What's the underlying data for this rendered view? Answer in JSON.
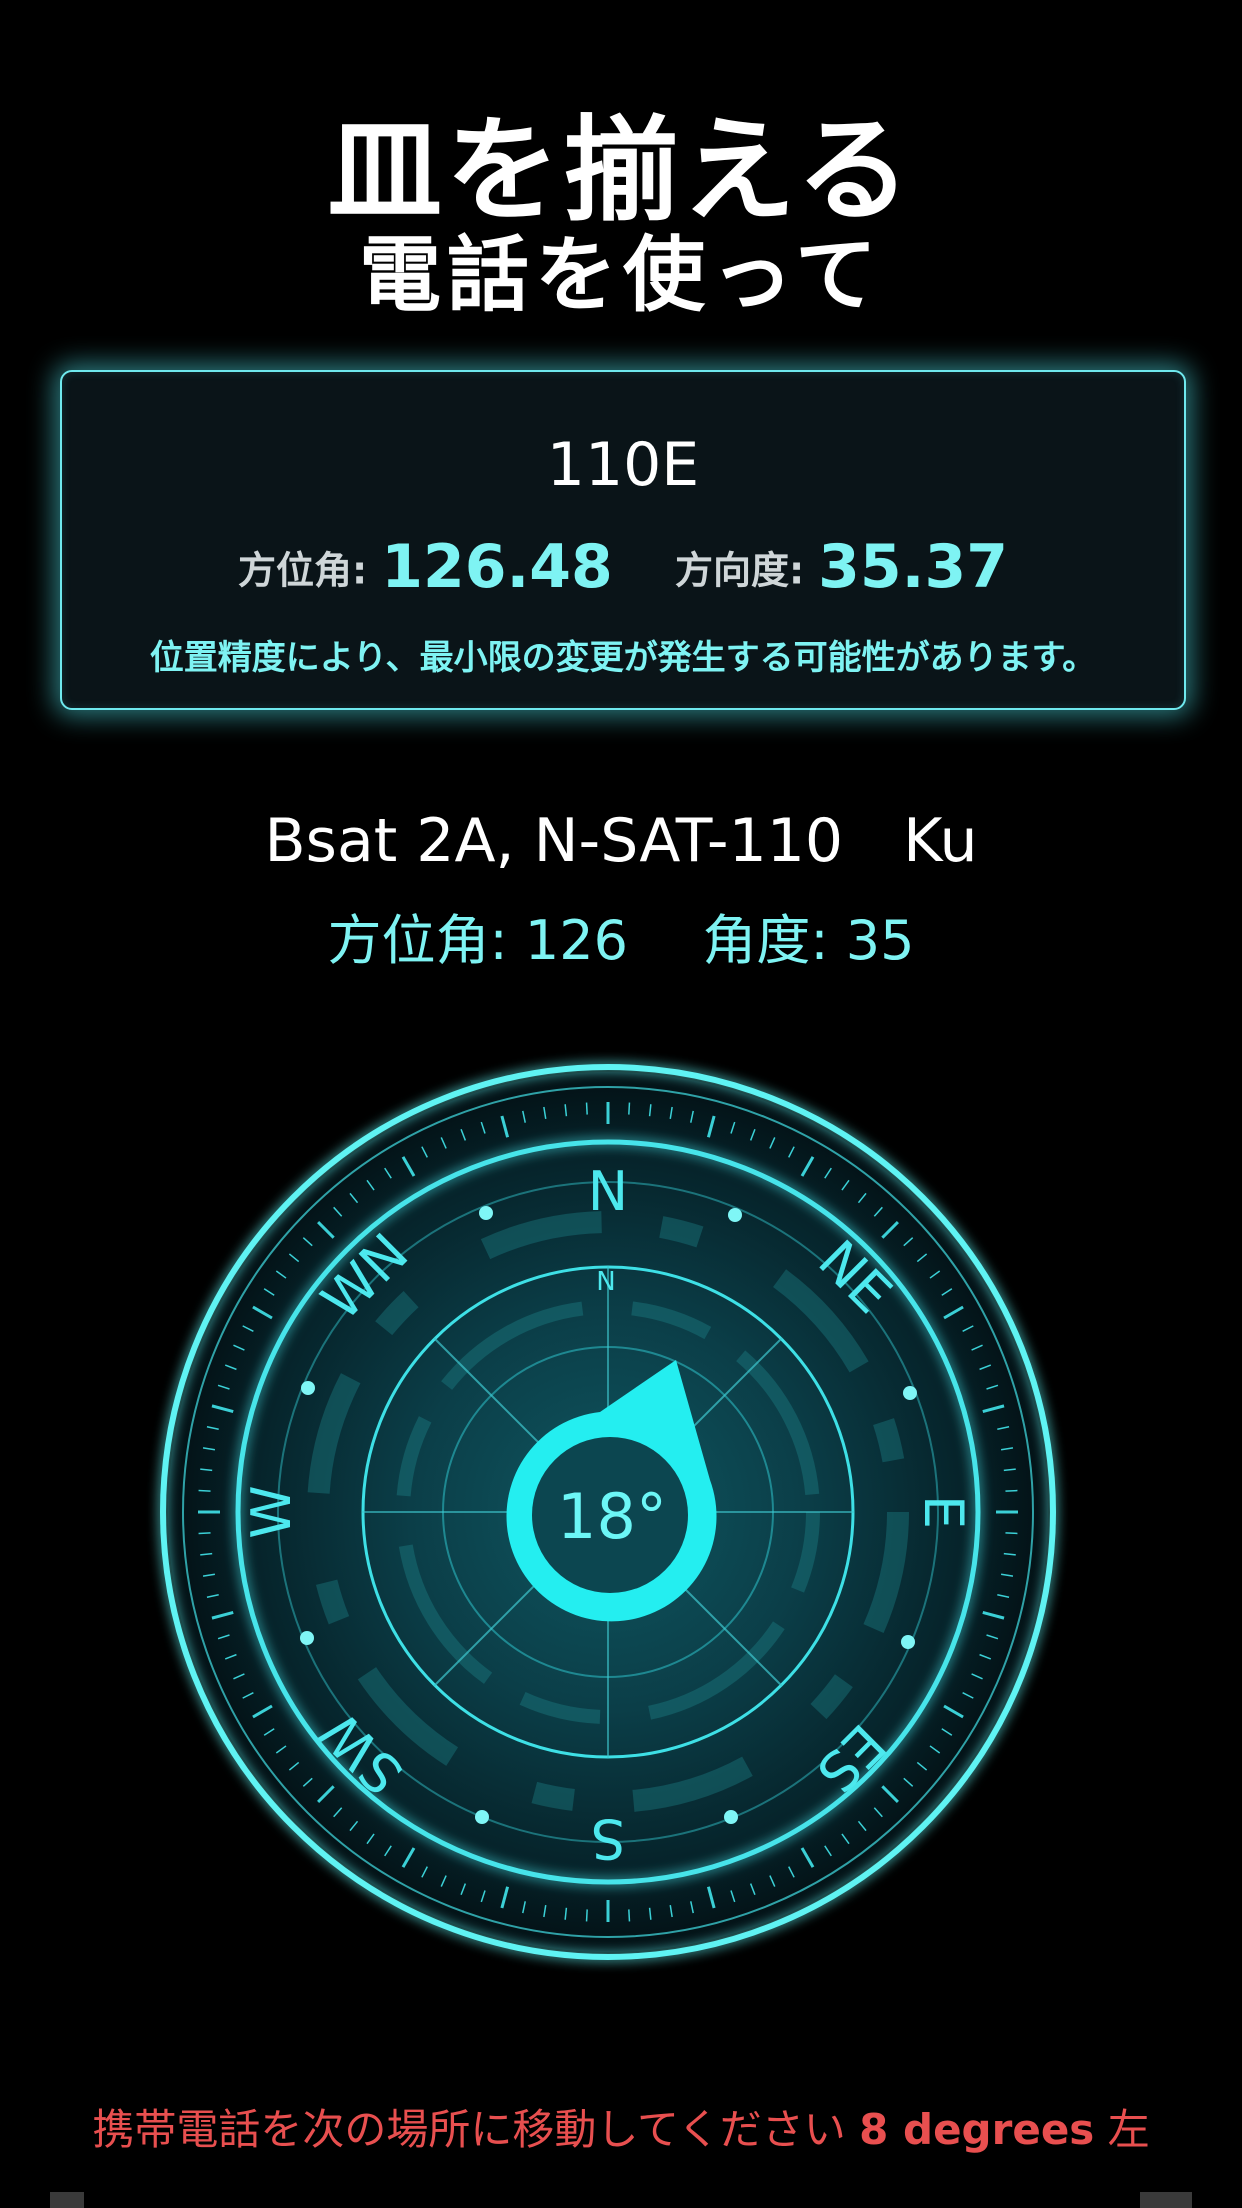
{
  "header": {
    "title": "皿を揃える",
    "subtitle": "電話を使って"
  },
  "card": {
    "satellite": "110E",
    "azimuth_label": "方位角:",
    "azimuth_value": "126.48",
    "elevation_label": "方向度:",
    "elevation_value": "35.37",
    "note": "位置精度により、最小限の変更が発生する可能性があります。"
  },
  "satellite_info": {
    "name": "Bsat 2A, N-SAT-110　Ku",
    "azimuth_label": "方位角:",
    "azimuth_value": "126",
    "angle_label": "角度:",
    "angle_value": "35"
  },
  "compass": {
    "heading": "18°",
    "labels": {
      "n": "N",
      "ne": "NE",
      "e": "E",
      "es": "ES",
      "s": "S",
      "sw": "SW",
      "w": "W",
      "wn": "WN",
      "inner_n": "N"
    },
    "accent": "#2ee6ea"
  },
  "instruction": {
    "prefix": "携帯電話を次の場所に移動してください ",
    "degrees": "8 degrees",
    "direction": " 左"
  }
}
